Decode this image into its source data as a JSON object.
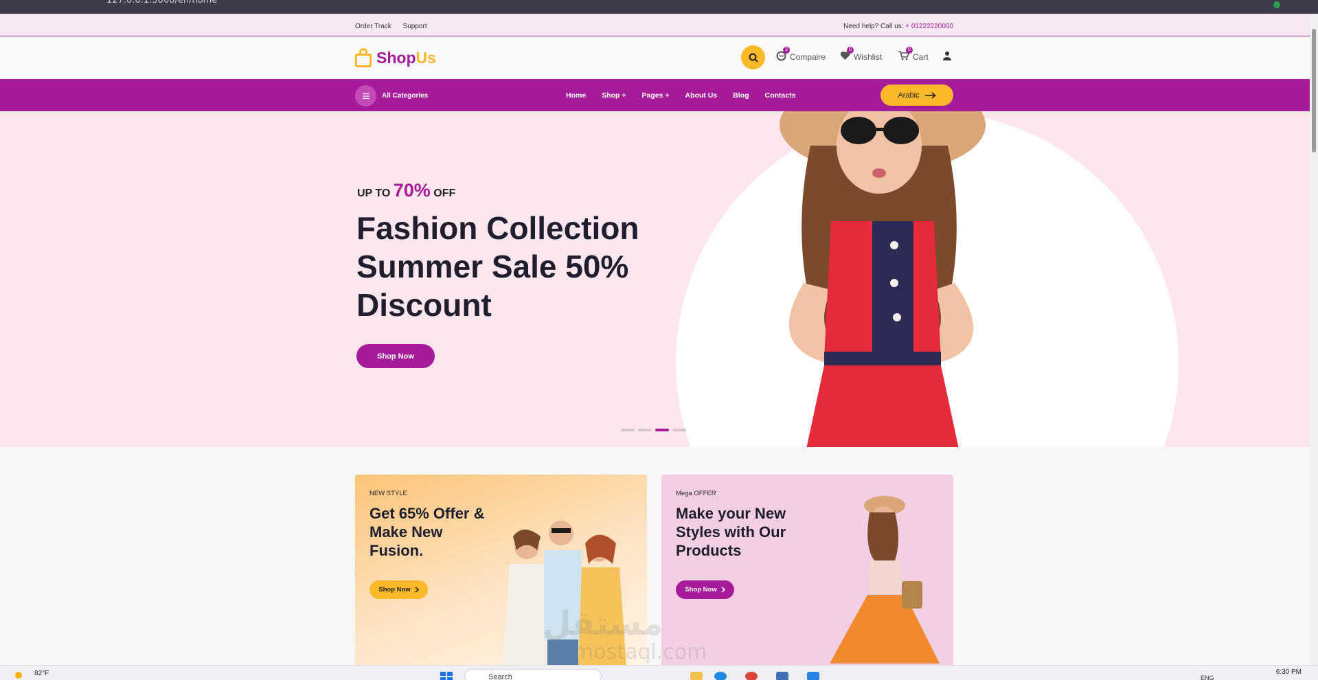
{
  "browser": {
    "url": "127.0.0.1:3000/en/home"
  },
  "topbar": {
    "links": [
      "Order Track",
      "Support"
    ],
    "help_text": "Need help? Call us:",
    "phone": "+ 01222220000"
  },
  "header": {
    "logo_part1": "Shop",
    "logo_part2": "Us",
    "compare_label": "Compaire",
    "compare_count": "3",
    "wishlist_label": "Wishlist",
    "wishlist_count": "0",
    "cart_label": "Cart",
    "cart_count": "0"
  },
  "nav": {
    "categories_label": "All Categories",
    "menu": [
      "Home",
      "Shop +",
      "Pages +",
      "About Us",
      "Blog",
      "Contacts"
    ],
    "language_button": "Arabic"
  },
  "hero": {
    "offer_prefix": "UP TO",
    "offer_pct": "70%",
    "offer_suffix": "OFF",
    "headline": "Fashion Collection Summer Sale 50% Discount",
    "button": "Shop Now",
    "slides": 4,
    "active_slide": 3
  },
  "banners": [
    {
      "tag": "NEW STYLE",
      "title": "Get 65% Offer & Make New Fusion.",
      "button": "Shop Now"
    },
    {
      "tag": "Mega OFFER",
      "title": "Make your New Styles with Our Products",
      "button": "Shop Now"
    }
  ],
  "watermark": {
    "arabic": "مستقل",
    "latin": "mostaql.com"
  },
  "taskbar": {
    "weather": "82°F",
    "search_placeholder": "Search",
    "language": "ENG",
    "time": "6:30 PM"
  },
  "colors": {
    "primary": "#a61b9a",
    "accent": "#fbb829",
    "hero_bg": "#fde6ec"
  }
}
